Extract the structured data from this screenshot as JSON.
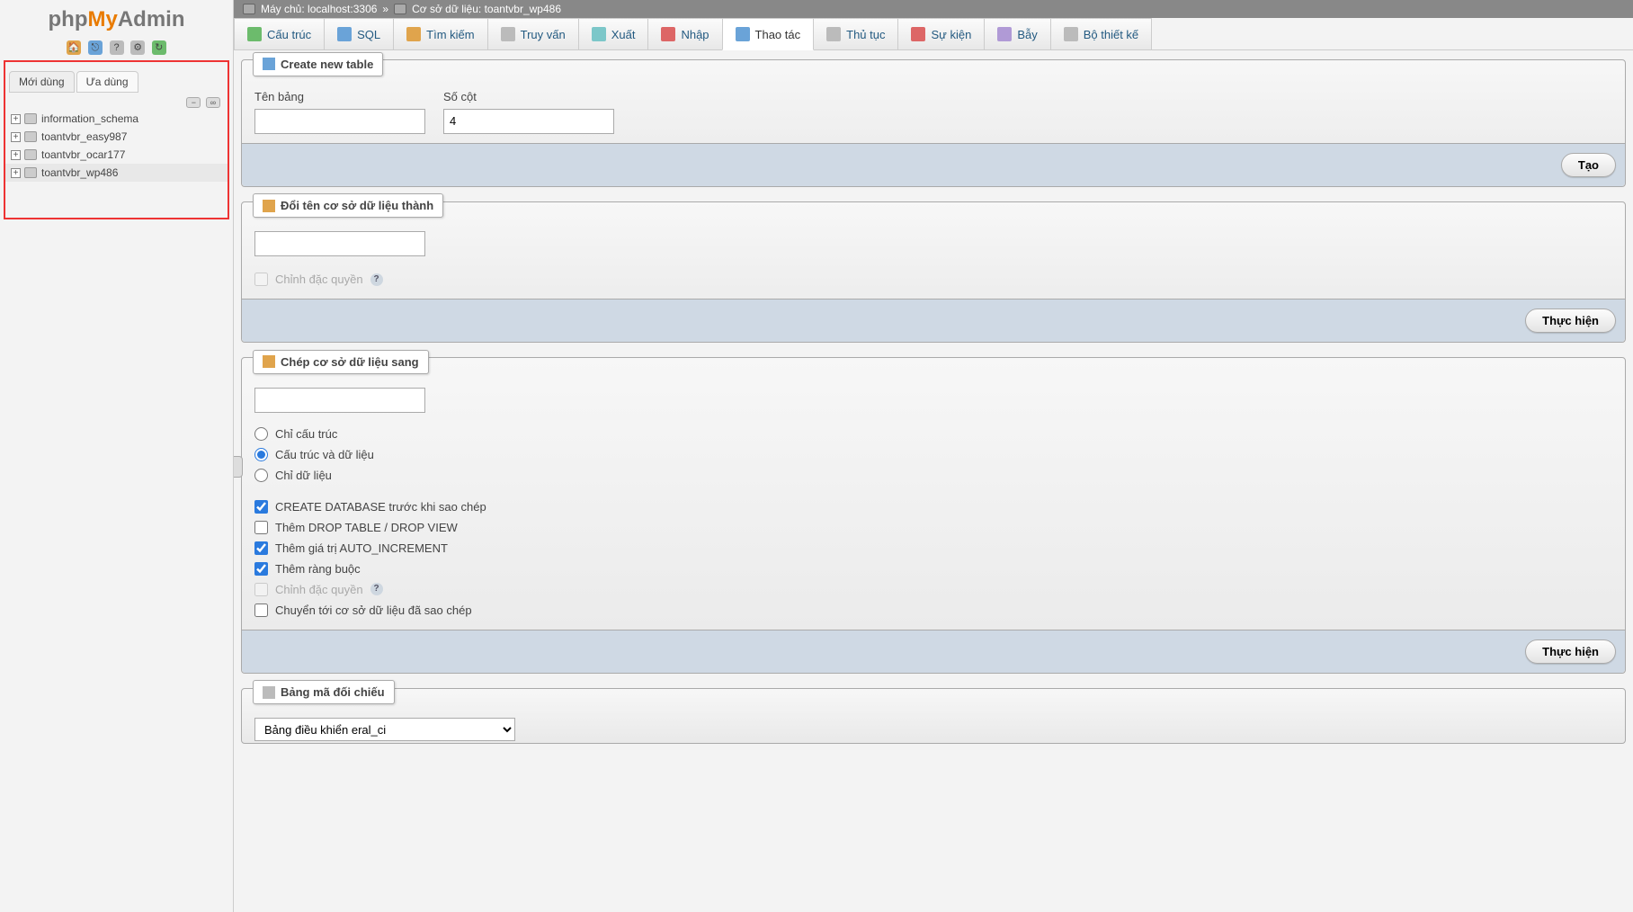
{
  "logo": {
    "p1": "php",
    "p2": "My",
    "p3": "Admin"
  },
  "sidebar_tabs": {
    "recent": "Mới dùng",
    "favorite": "Ưa dùng"
  },
  "databases": [
    {
      "name": "information_schema",
      "selected": false
    },
    {
      "name": "toantvbr_easy987",
      "selected": false
    },
    {
      "name": "toantvbr_ocar177",
      "selected": false
    },
    {
      "name": "toantvbr_wp486",
      "selected": true
    }
  ],
  "breadcrumb": {
    "server_label": "Máy chủ:",
    "server_value": "localhost:3306",
    "sep": "»",
    "db_label": "Cơ sở dữ liệu:",
    "db_value": "toantvbr_wp486"
  },
  "tabs": [
    {
      "id": "structure",
      "label": "Cấu trúc"
    },
    {
      "id": "sql",
      "label": "SQL"
    },
    {
      "id": "search",
      "label": "Tìm kiếm"
    },
    {
      "id": "query",
      "label": "Truy vấn"
    },
    {
      "id": "export",
      "label": "Xuất"
    },
    {
      "id": "import",
      "label": "Nhập"
    },
    {
      "id": "operations",
      "label": "Thao tác"
    },
    {
      "id": "routines",
      "label": "Thủ tục"
    },
    {
      "id": "events",
      "label": "Sự kiện"
    },
    {
      "id": "triggers",
      "label": "Bẫy"
    },
    {
      "id": "designer",
      "label": "Bộ thiết kế"
    }
  ],
  "active_tab": "operations",
  "panels": {
    "create_table": {
      "legend": "Create new table",
      "name_label": "Tên bảng",
      "name_value": "",
      "cols_label": "Số cột",
      "cols_value": "4",
      "submit": "Tạo"
    },
    "rename_db": {
      "legend": "Đổi tên cơ sở dữ liệu thành",
      "value": "",
      "adjust_priv": "Chỉnh đặc quyền",
      "submit": "Thực hiện"
    },
    "copy_db": {
      "legend": "Chép cơ sở dữ liệu sang",
      "value": "",
      "radios": {
        "structure_only": "Chỉ cấu trúc",
        "structure_and_data": "Cấu trúc và dữ liệu",
        "data_only": "Chỉ dữ liệu"
      },
      "radio_selected": "structure_and_data",
      "checks": {
        "create_db": {
          "label": "CREATE DATABASE trước khi sao chép",
          "checked": true
        },
        "add_drop": {
          "label": "Thêm DROP TABLE / DROP VIEW",
          "checked": false
        },
        "add_autoinc": {
          "label": "Thêm giá trị AUTO_INCREMENT",
          "checked": true
        },
        "add_constraints": {
          "label": "Thêm ràng buộc",
          "checked": true
        },
        "adjust_priv": {
          "label": "Chỉnh đặc quyền",
          "checked": false,
          "disabled": true
        },
        "switch_db": {
          "label": "Chuyển tới cơ sở dữ liệu đã sao chép",
          "checked": false
        }
      },
      "submit": "Thực hiện"
    },
    "collation": {
      "legend": "Bảng mã đối chiếu",
      "select_value": "Bảng điều khiển eral_ci"
    }
  }
}
